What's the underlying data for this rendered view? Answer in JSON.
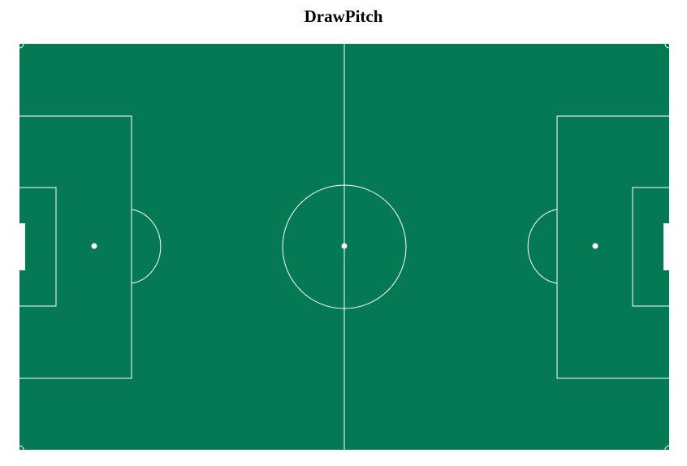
{
  "title": "DrawPitch",
  "pitch": {
    "length_m": 105,
    "width_m": 68,
    "surface_color": "#047954",
    "line_color": "#ffffff",
    "features": [
      "touchlines",
      "halfway-line",
      "centre-circle",
      "centre-spot",
      "penalty-areas",
      "goal-areas",
      "penalty-spots",
      "penalty-arcs",
      "goals",
      "corner-arcs"
    ]
  }
}
